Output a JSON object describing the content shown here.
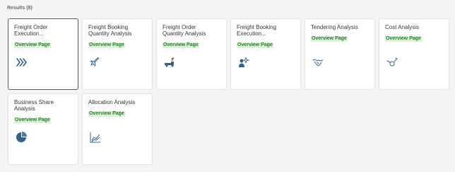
{
  "results_header": "Results (8)",
  "tiles": [
    {
      "title": "Freight Order\nExecution...",
      "subtitle": "Overview Page",
      "icon": "chevrons-right-icon"
    },
    {
      "title": "Freight Booking\nQuantity Analysis",
      "subtitle": "Overview Page",
      "icon": "plane-icon"
    },
    {
      "title": "Freight Order\nQuantity Analysis",
      "subtitle": "Overview Page",
      "icon": "truck-icon"
    },
    {
      "title": "Freight Booking\nExecution...",
      "subtitle": "Overview Page",
      "icon": "person-plane-icon"
    },
    {
      "title": "Tendering Analysis",
      "subtitle": "Overview Page",
      "icon": "handshake-icon"
    },
    {
      "title": "Cost Analysis",
      "subtitle": "Overview Page",
      "icon": "cost-icon"
    },
    {
      "title": "Business Share\nAnalysis",
      "subtitle": "Overview Page",
      "icon": "pie-chart-icon"
    },
    {
      "title": "Allocation Analysis",
      "subtitle": "Overview Page",
      "icon": "area-chart-icon"
    }
  ],
  "colors": {
    "icon": "#346187",
    "subtitle_text": "#2b7d2b",
    "subtitle_highlight": "#dcefd9"
  }
}
